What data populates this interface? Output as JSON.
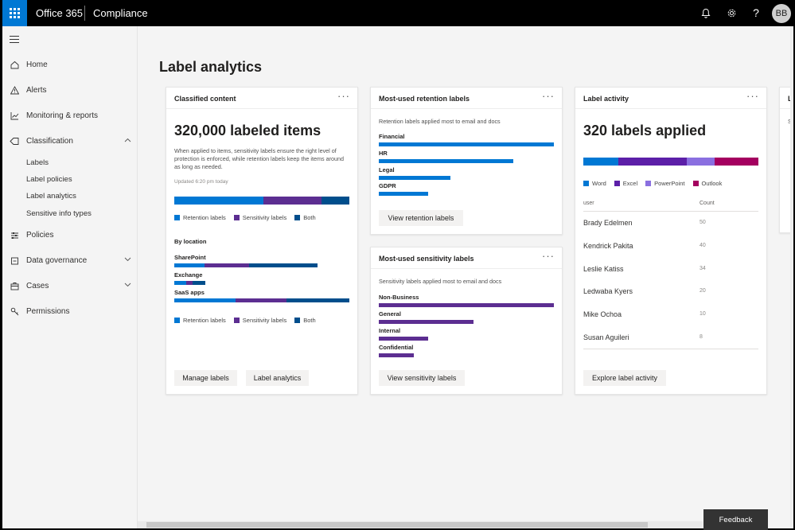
{
  "topbar": {
    "brand": "Office 365",
    "app": "Compliance",
    "avatar_initials": "BB",
    "icons": [
      "waffle-icon",
      "bell-icon",
      "gear-icon",
      "help-icon"
    ]
  },
  "sidebar": {
    "items": [
      {
        "label": "Home",
        "icon": "home-icon"
      },
      {
        "label": "Alerts",
        "icon": "alert-icon"
      },
      {
        "label": "Monitoring & reports",
        "icon": "chart-icon"
      },
      {
        "label": "Classification",
        "icon": "tag-icon"
      },
      {
        "label": "Policies",
        "icon": "sliders-icon"
      },
      {
        "label": "Data governance",
        "icon": "lock-icon"
      },
      {
        "label": "Cases",
        "icon": "briefcase-icon"
      },
      {
        "label": "Permissions",
        "icon": "key-icon"
      }
    ],
    "subitems": [
      "Labels",
      "Label policies",
      "Label analytics",
      "Sensitive info types"
    ]
  },
  "page": {
    "title": "Label analytics"
  },
  "card1": {
    "title": "Classified content",
    "big": "320,000 labeled items",
    "desc": "When applied to items, sensitivity labels ensure the right level of protection is enforced, while retention labels keep the items around as long as needed.",
    "updated": "Updated 6:20 pm today",
    "legend": [
      "Retention labels",
      "Sensitivity labels",
      "Both"
    ],
    "by_location": "By location",
    "locations": [
      "SharePoint",
      "Exchange",
      "SaaS apps"
    ],
    "btn1": "Manage labels",
    "btn2": "Label analytics"
  },
  "card2": {
    "title": "Most-used retention labels",
    "desc": "Retention labels applied most to email and docs",
    "labels": [
      "Financial",
      "HR",
      "Legal",
      "GDPR"
    ],
    "fractions": [
      1.0,
      0.77,
      0.41,
      0.28
    ],
    "btn": "View retention labels"
  },
  "card3": {
    "title": "Most-used sensitivity labels",
    "desc": "Sensitivity labels applied most to email and docs",
    "labels": [
      "Non-Business",
      "General",
      "Internal",
      "Confidential"
    ],
    "fractions": [
      1.0,
      0.54,
      0.28,
      0.2
    ],
    "btn": "View sensitivity labels"
  },
  "card4": {
    "title": "Label activity",
    "big": "320 labels applied",
    "legend": [
      "Word",
      "Excel",
      "PowerPoint",
      "Outlook"
    ],
    "col_user": "user",
    "col_count": "Count",
    "rows": [
      {
        "name": "Brady Edelmen",
        "count": "50"
      },
      {
        "name": "Kendrick Pakita",
        "count": "40"
      },
      {
        "name": "Leslie Katiss",
        "count": "34"
      },
      {
        "name": "Ledwaba Kyers",
        "count": "20"
      },
      {
        "name": "Mike Ochoa",
        "count": "10"
      },
      {
        "name": "Susan Aguileri",
        "count": "8"
      }
    ],
    "btn": "Explore label activity"
  },
  "card5": {
    "title": "La",
    "desc": "S"
  },
  "feedback": "Feedback",
  "colors": {
    "retention": "#0078d4",
    "sensitivity": "#5c2e91",
    "both": "#004e8c",
    "word": "#0078d4",
    "excel": "#5c1fa8",
    "powerpoint": "#8a6fe0",
    "outlook": "#a4005f"
  }
}
